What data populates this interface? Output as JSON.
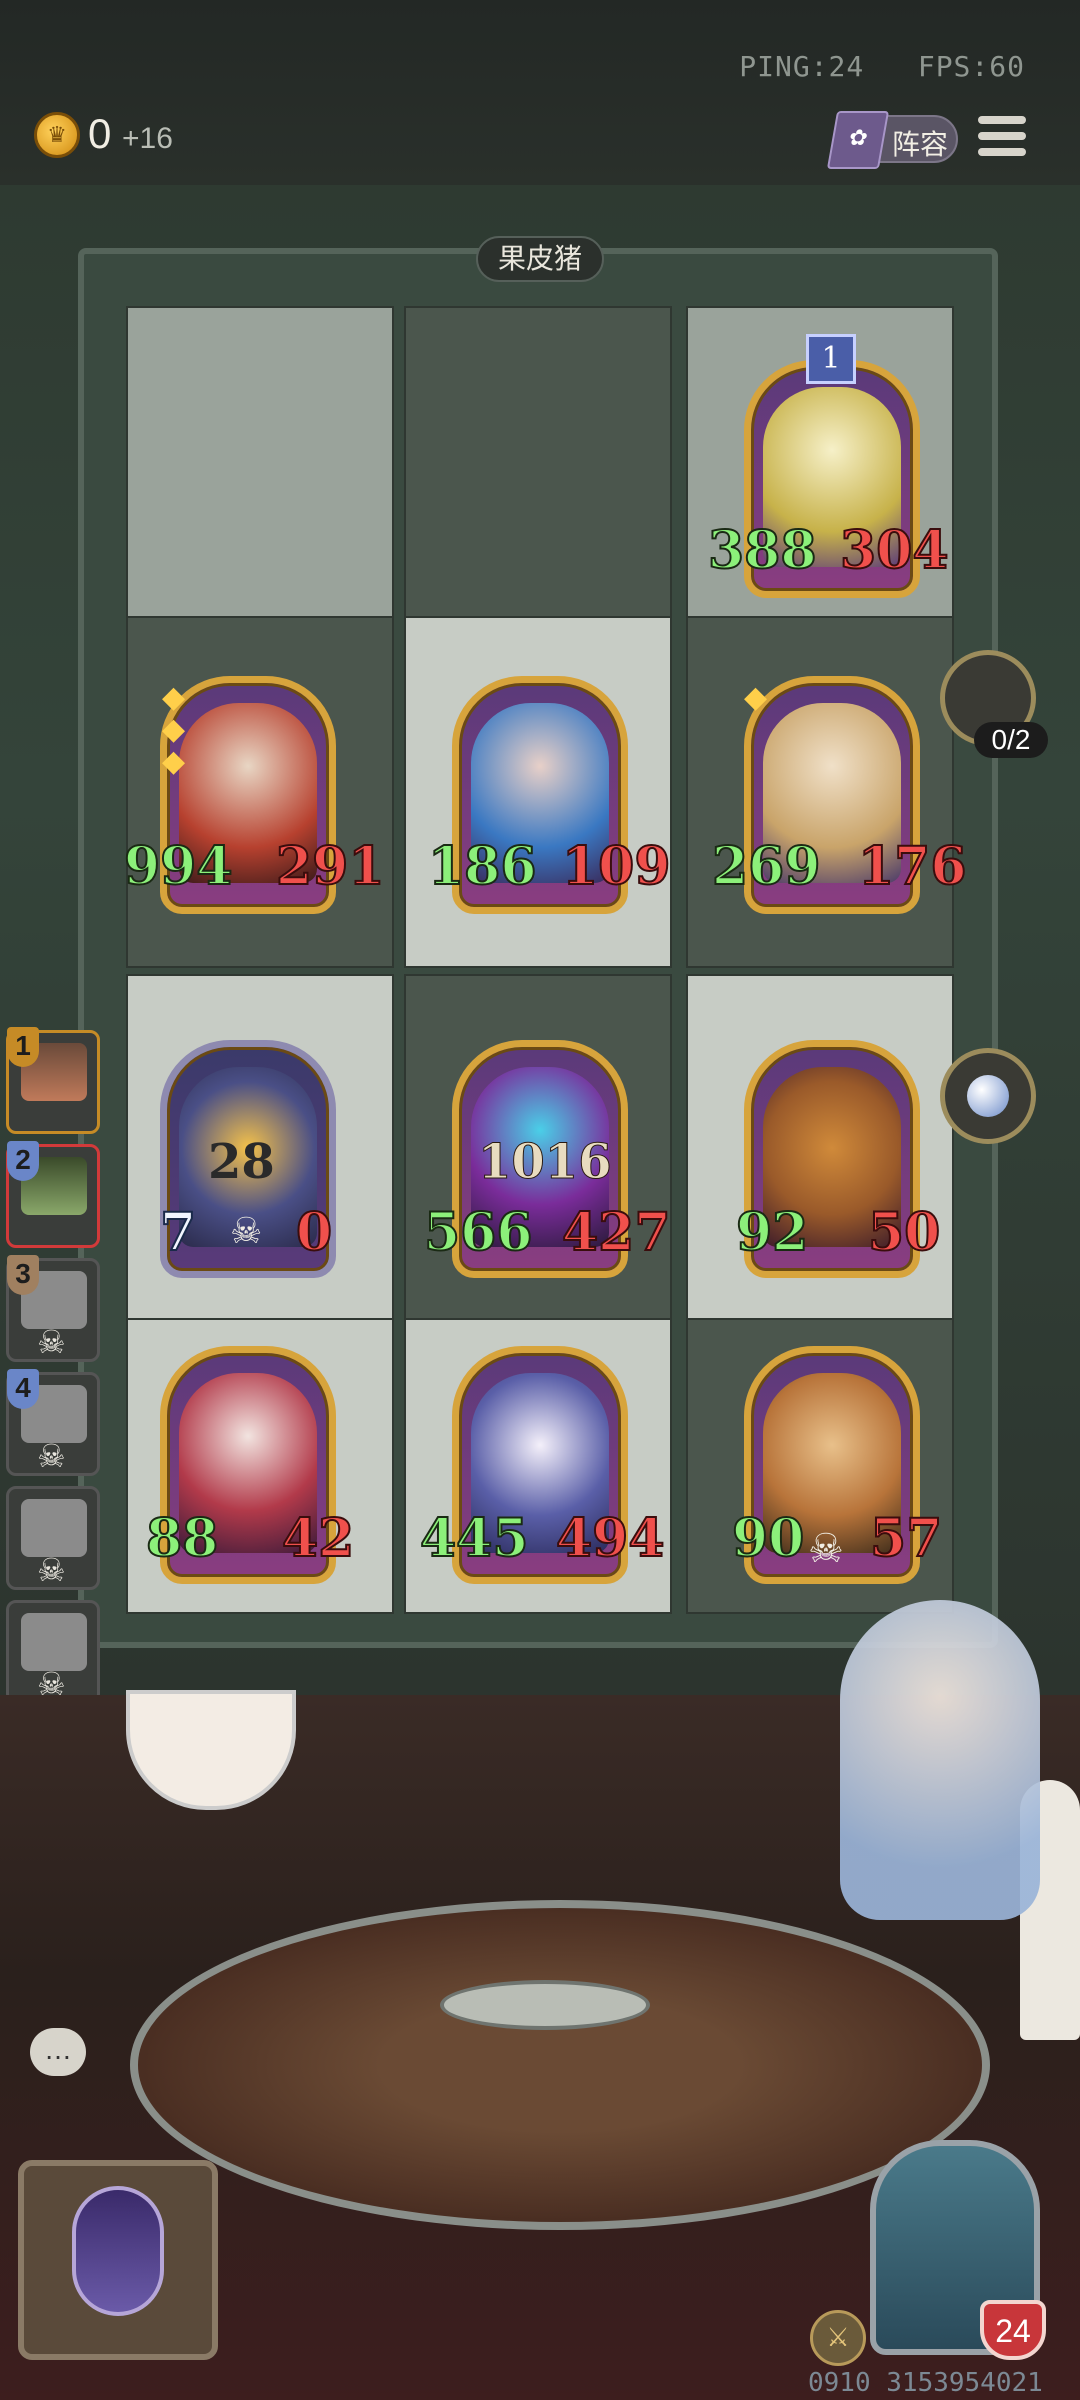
{
  "status": {
    "ping": "PING:24",
    "fps": "FPS:60"
  },
  "economy": {
    "gold": "0",
    "income": "+16"
  },
  "toolbar": {
    "lineup_label": "阵容",
    "lineup_icon": "book-icon",
    "menu_icon": "hamburger-icon"
  },
  "board": {
    "title": "果皮猪",
    "rows": [
      [
        null,
        null,
        {
          "atk": "388",
          "hp": "304",
          "tier": "1",
          "color": "#c7b24a"
        }
      ],
      [
        {
          "atk": "994",
          "hp": "291",
          "color": "#b7412f"
        },
        {
          "atk": "186",
          "hp": "109",
          "color": "#3a78c2"
        },
        {
          "atk": "269",
          "hp": "176",
          "color": "#c9a46a"
        }
      ],
      [
        {
          "atk": "7",
          "hp": "0",
          "center": "28",
          "color": "#4a4f86"
        },
        {
          "atk": "566",
          "hp": "427",
          "center": "1016",
          "color": "#7a2c9a"
        },
        {
          "atk": "92",
          "hp": "50",
          "color": "#9a5a2a"
        }
      ],
      [
        {
          "atk": "88",
          "hp": "42",
          "color": "#b23a4a"
        },
        {
          "atk": "445",
          "hp": "494",
          "color": "#5a5fa8"
        },
        {
          "atk": "90",
          "hp": "57",
          "color": "#b8743a"
        }
      ]
    ]
  },
  "items": {
    "count": "0/2"
  },
  "players": [
    {
      "rank": "1"
    },
    {
      "rank": "2"
    },
    {
      "rank": "3"
    },
    {
      "rank": "4"
    },
    {
      "rank": ""
    },
    {
      "rank": ""
    },
    {
      "rank": ""
    },
    {
      "rank": ""
    }
  ],
  "player": {
    "hp": "24"
  },
  "footer": {
    "id": "0910 3153954021"
  }
}
